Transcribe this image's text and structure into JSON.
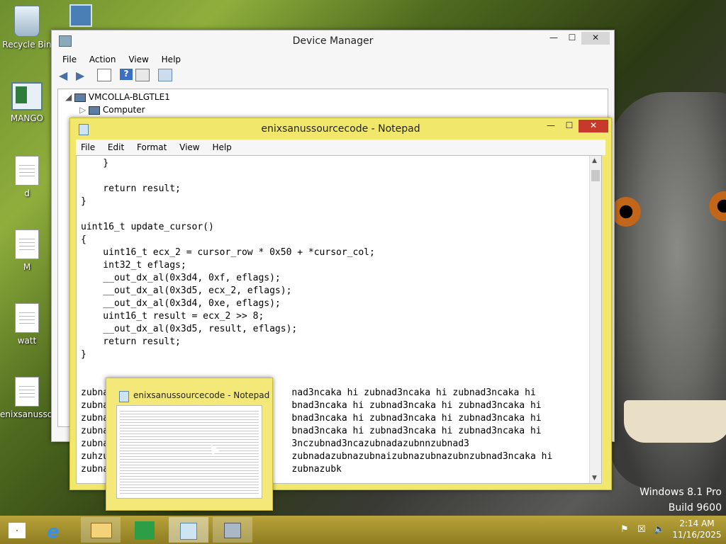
{
  "desktop": {
    "icons": [
      {
        "label": "Recycle Bin"
      },
      {
        "label": "MANGO"
      },
      {
        "label": "d"
      },
      {
        "label": "M"
      },
      {
        "label": "watt"
      },
      {
        "label": "enixsanusso..."
      }
    ],
    "watermark": {
      "line1": "Windows 8.1 Pro",
      "line2": "Build 9600"
    }
  },
  "device_manager": {
    "title": "Device Manager",
    "menu": [
      "File",
      "Action",
      "View",
      "Help"
    ],
    "tree": {
      "root": "VMCOLLA-BLGTLE1",
      "child": "Computer"
    },
    "controls": {
      "min": "—",
      "max": "☐",
      "close": "✕"
    }
  },
  "notepad": {
    "title": "enixsanussourcecode - Notepad",
    "menu": [
      "File",
      "Edit",
      "Format",
      "View",
      "Help"
    ],
    "lines": [
      "    }",
      "",
      "    return result;",
      "}",
      "",
      "uint16_t update_cursor()",
      "{",
      "    uint16_t ecx_2 = cursor_row * 0x50 + *cursor_col;",
      "    int32_t eflags;",
      "    __out_dx_al(0x3d4, 0xf, eflags);",
      "    __out_dx_al(0x3d5, ecx_2, eflags);",
      "    __out_dx_al(0x3d4, 0xe, eflags);",
      "    uint16_t result = ecx_2 >> 8;",
      "    __out_dx_al(0x3d5, result, eflags);",
      "    return result;",
      "}",
      "",
      "",
      "zubna                                 nad3ncaka hi zubnad3ncaka hi zubnad3ncaka hi",
      "zubna                                 bnad3ncaka hi zubnad3ncaka hi zubnad3ncaka hi",
      "zubna                                 bnad3ncaka hi zubnad3ncaka hi zubnad3ncaka hi",
      "zubna                                 bnad3ncaka hi zubnad3ncaka hi zubnad3ncaka hi",
      "zubna                                 3nczubnad3ncazubnadazubnnzubnad3",
      "zuhzu                                 zubnadazubnazubnaizubnazubnazubnzubnad3ncaka hi",
      "zubna                                 zubnazubk"
    ],
    "controls": {
      "min": "—",
      "max": "☐",
      "close": "✕"
    }
  },
  "thumbnail": {
    "title": "enixsanussourcecode - Notepad"
  },
  "taskbar": {
    "clock": {
      "time": "2:14 AM",
      "date": "11/16/2025"
    }
  }
}
